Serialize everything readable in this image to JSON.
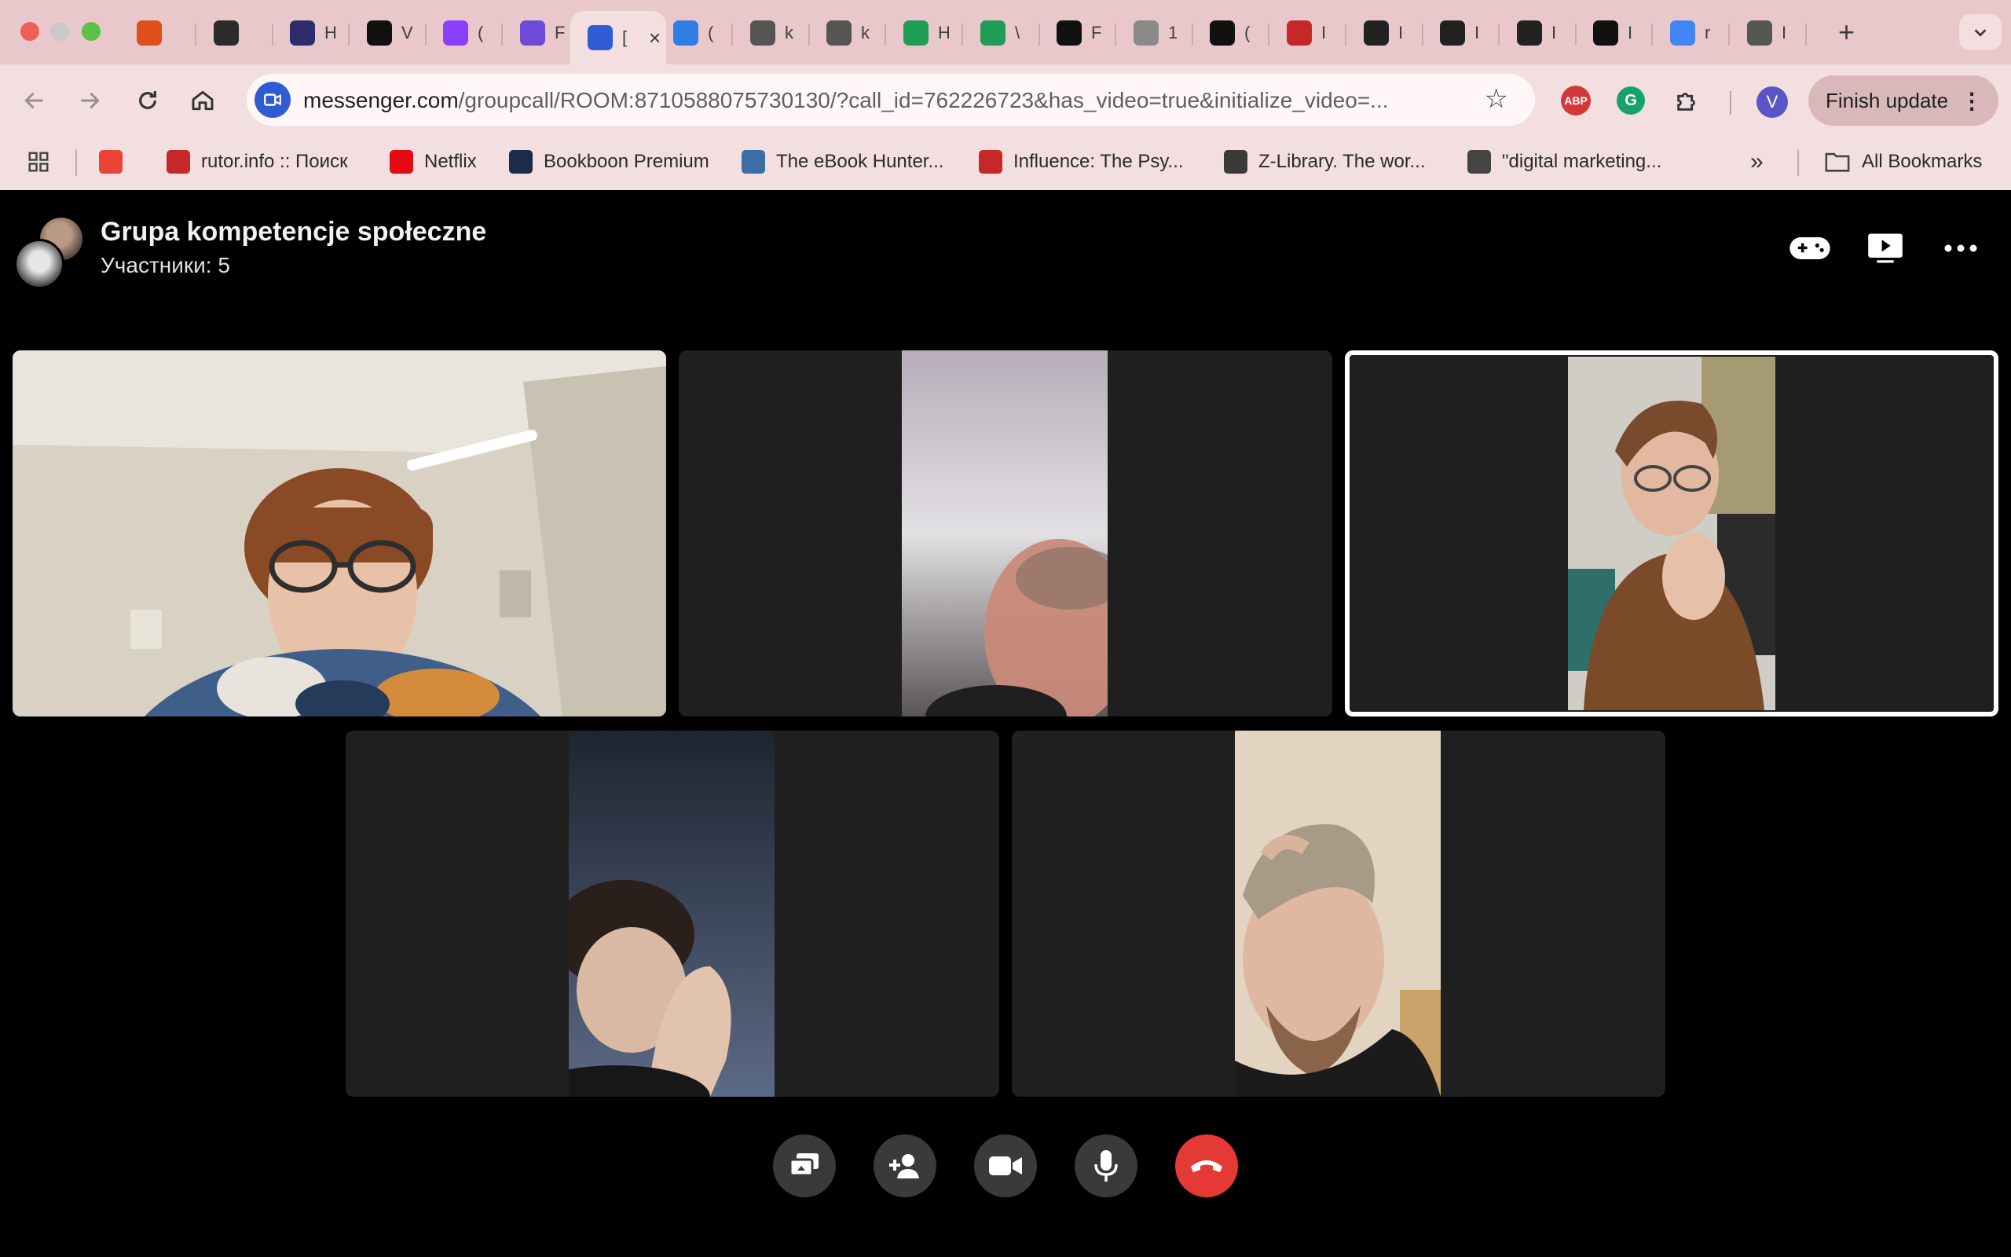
{
  "browser": {
    "tabs": [
      {
        "icon": "triangle-icon",
        "title": "",
        "color": "#e04e1b"
      },
      {
        "icon": "chart-line-icon",
        "title": "",
        "color": "#2b2b2b"
      },
      {
        "icon": "hashnode-icon",
        "title": "H",
        "color": "#2d2d6e"
      },
      {
        "icon": "notion-icon",
        "title": "V",
        "color": "#111111"
      },
      {
        "icon": "messenger-icon",
        "title": "(",
        "color": "#8a3ffc"
      },
      {
        "icon": "owl-icon",
        "title": "F",
        "color": "#6d4bd8"
      },
      {
        "icon": "messenger-video-icon",
        "title": "[",
        "color": "#2f5bd4",
        "active": true
      },
      {
        "icon": "infinity-icon",
        "title": "(",
        "color": "#2f7ee6"
      },
      {
        "icon": "globe-icon",
        "title": "k",
        "color": "#555555"
      },
      {
        "icon": "globe-icon",
        "title": "k",
        "color": "#555555"
      },
      {
        "icon": "w-icon",
        "title": "H",
        "color": "#1f9d55"
      },
      {
        "icon": "w-icon",
        "title": "\\",
        "color": "#1f9d55"
      },
      {
        "icon": "framer-icon",
        "title": "F",
        "color": "#111111"
      },
      {
        "icon": "globe-icon",
        "title": "1",
        "color": "#8a8a8a"
      },
      {
        "icon": "openai-icon",
        "title": "(",
        "color": "#111111"
      },
      {
        "icon": "pd-icon",
        "title": "I",
        "color": "#c62828"
      },
      {
        "icon": "github-icon",
        "title": "I",
        "color": "#222222"
      },
      {
        "icon": "github-icon",
        "title": "I",
        "color": "#222222"
      },
      {
        "icon": "github-icon",
        "title": "I",
        "color": "#222222"
      },
      {
        "icon": "esk-icon",
        "title": "I",
        "color": "#111111"
      },
      {
        "icon": "google-icon",
        "title": "r",
        "color": "#4285f4"
      },
      {
        "icon": "chrome-icon",
        "title": "I",
        "color": "#555555"
      }
    ],
    "url_host": "messenger.com",
    "url_path": "/groupcall/ROOM:8710588075730130/?call_id=762226723&has_video=true&initialize_video=...",
    "extensions": [
      "ABP",
      "G"
    ],
    "profile_initial": "V",
    "finish_update_label": "Finish update",
    "bookmarks": [
      {
        "label": "",
        "icon": "gmail-icon",
        "color": "#ea4335"
      },
      {
        "label": "rutor.info :: Поиск",
        "icon": "rutor-icon",
        "color": "#c62828"
      },
      {
        "label": "Netflix",
        "icon": "netflix-icon",
        "color": "#e50914"
      },
      {
        "label": "Bookboon Premium",
        "icon": "bookboon-icon",
        "color": "#1c2b4a"
      },
      {
        "label": "The eBook Hunter...",
        "icon": "ebook-icon",
        "color": "#3a6ea5"
      },
      {
        "label": "Influence: The Psy...",
        "icon": "pdf-icon",
        "color": "#c62828"
      },
      {
        "label": "Z-Library. The wor...",
        "icon": "zlib-icon",
        "color": "#3a3a3a"
      },
      {
        "label": "\"digital marketing...",
        "icon": "globe-icon",
        "color": "#444444"
      }
    ],
    "all_bookmarks_label": "All Bookmarks"
  },
  "call": {
    "title": "Grupa kompetencje społeczne",
    "participants": "Участники: 5",
    "tiles": [
      {
        "name": "participant-1",
        "speaking": false
      },
      {
        "name": "participant-2",
        "speaking": false
      },
      {
        "name": "participant-3",
        "speaking": true
      },
      {
        "name": "participant-4",
        "speaking": false
      },
      {
        "name": "participant-5",
        "speaking": false
      }
    ]
  },
  "colors": {
    "end_call": "#e53935",
    "control_bg": "#3a3a3a",
    "tile_bg": "#1f1f1f"
  }
}
